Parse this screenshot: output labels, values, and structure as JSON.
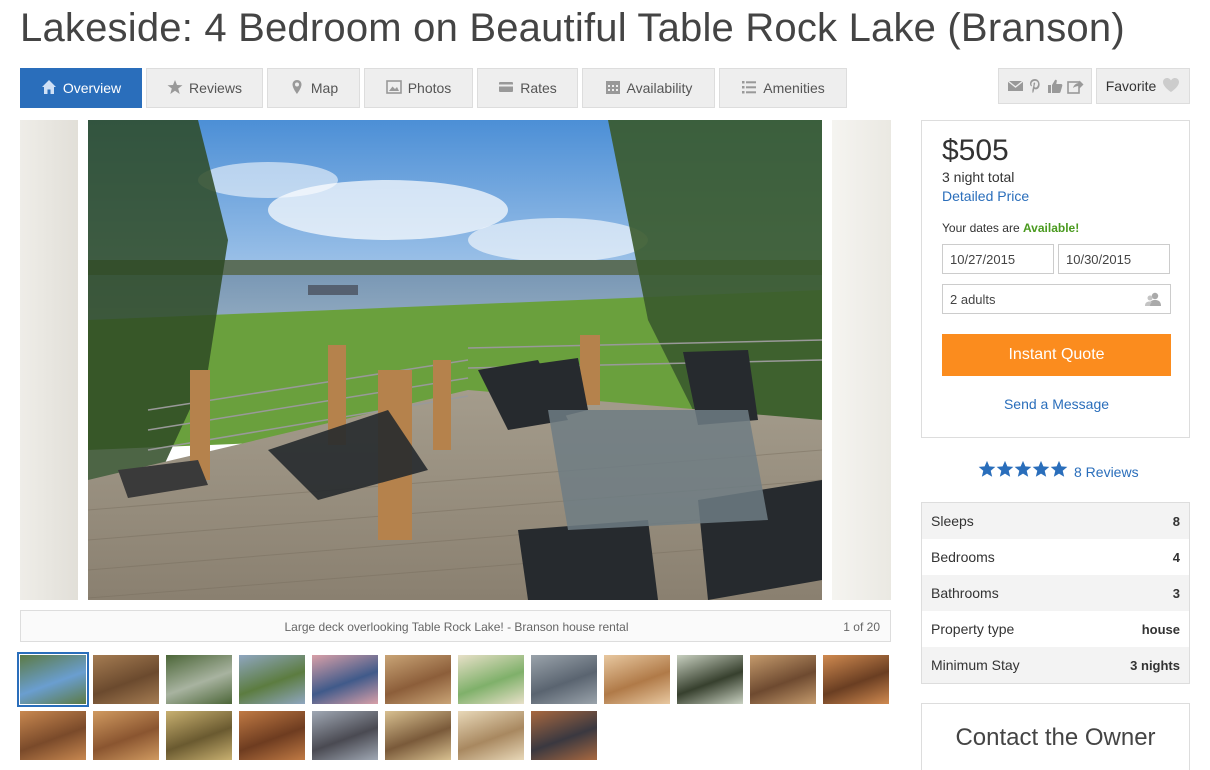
{
  "listing": {
    "title": "Lakeside: 4 Bedroom on Beautiful Table Rock Lake (Branson)"
  },
  "tabs": [
    {
      "label": "Overview",
      "icon": "home-icon"
    },
    {
      "label": "Reviews",
      "icon": "star-icon"
    },
    {
      "label": "Map",
      "icon": "map-pin-icon"
    },
    {
      "label": "Photos",
      "icon": "photo-icon"
    },
    {
      "label": "Rates",
      "icon": "rates-icon"
    },
    {
      "label": "Availability",
      "icon": "calendar-icon"
    },
    {
      "label": "Amenities",
      "icon": "list-icon"
    }
  ],
  "share": {
    "icons": [
      "email-icon",
      "pinterest-icon",
      "thumbs-up-icon",
      "share-icon"
    ]
  },
  "favorite": {
    "label": "Favorite",
    "icon": "heart-icon"
  },
  "gallery": {
    "caption": "Large deck overlooking Table Rock Lake! - Branson house rental",
    "count": "1 of 20",
    "selected_index": 0,
    "thumbnail_count": 20
  },
  "booking": {
    "price": "$505",
    "night_total": "3 night total",
    "detailed_price_link": "Detailed Price",
    "dates_prefix": "Your dates are ",
    "dates_status": "Available!",
    "checkin": "10/27/2015",
    "checkout": "10/30/2015",
    "guests": "2 adults",
    "quote_button": "Instant Quote",
    "send_message": "Send a Message"
  },
  "rating": {
    "stars": 5,
    "reviews_label": "8 Reviews",
    "color": "#2a6ebb"
  },
  "facts": [
    {
      "label": "Sleeps",
      "value": "8"
    },
    {
      "label": "Bedrooms",
      "value": "4"
    },
    {
      "label": "Bathrooms",
      "value": "3"
    },
    {
      "label": "Property type",
      "value": "house"
    },
    {
      "label": "Minimum Stay",
      "value": "3 nights"
    }
  ],
  "contact": {
    "title": "Contact the Owner"
  },
  "colors": {
    "accent": "#2a6ebb",
    "cta": "#fb8c1e",
    "available": "#4a9a1f"
  }
}
